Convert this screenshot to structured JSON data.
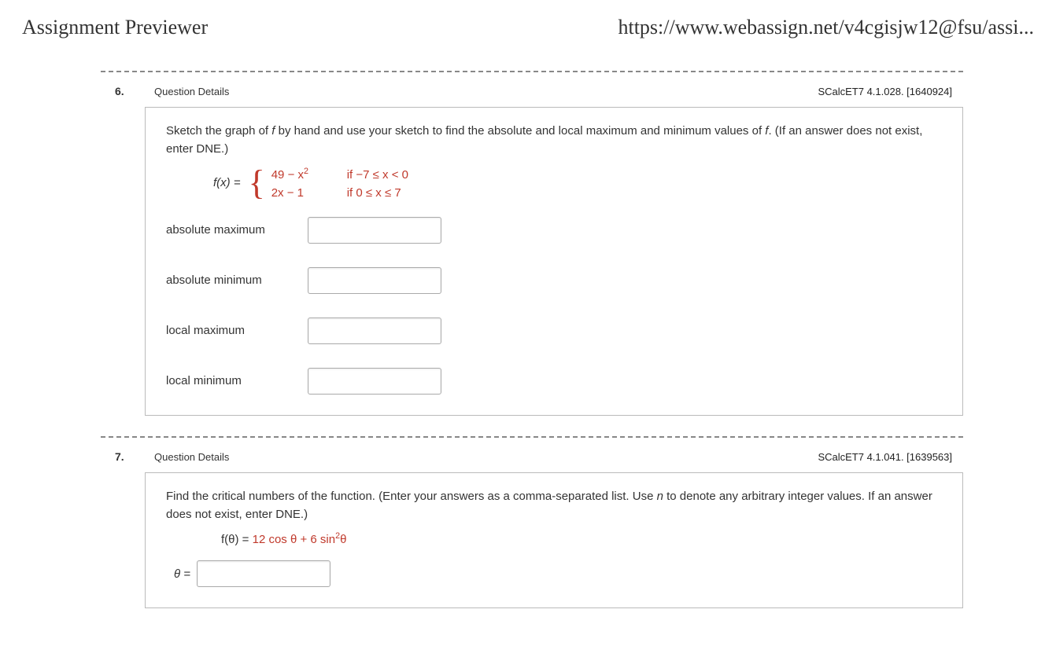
{
  "header": {
    "title": "Assignment Previewer",
    "url": "https://www.webassign.net/v4cgisjw12@fsu/assi..."
  },
  "questions": [
    {
      "number": "6.",
      "details_label": "Question Details",
      "source": "SCalcET7 4.1.028. [1640924]",
      "prompt_pre": "Sketch the graph of ",
      "prompt_ital1": "f",
      "prompt_mid": " by hand and use your sketch to find the absolute and local maximum and minimum values of ",
      "prompt_ital2": "f",
      "prompt_post": ". (If an answer does not exist, enter DNE.)",
      "fx_label": "f(x) =",
      "piecewise": [
        {
          "expr_a": "49 − x",
          "expr_sup": "2",
          "cond": "if −7 ≤ x < 0"
        },
        {
          "expr_a": "2x − 1",
          "expr_sup": "",
          "cond": "if 0 ≤ x ≤ 7"
        }
      ],
      "answers": [
        {
          "label": "absolute maximum"
        },
        {
          "label": "absolute minimum"
        },
        {
          "label": "local maximum"
        },
        {
          "label": "local minimum"
        }
      ]
    },
    {
      "number": "7.",
      "details_label": "Question Details",
      "source": "SCalcET7 4.1.041. [1639563]",
      "prompt_pre": "Find the critical numbers of the function. (Enter your answers as a comma-separated list. Use ",
      "prompt_ital1": "n",
      "prompt_post": " to denote any arbitrary integer values. If an answer does not exist, enter DNE.)",
      "formula_lhs": "f(θ) = ",
      "formula_rhs_a": "12 cos θ + 6 sin",
      "formula_rhs_sup": "2",
      "formula_rhs_b": "θ",
      "theta_label": "θ ="
    }
  ]
}
